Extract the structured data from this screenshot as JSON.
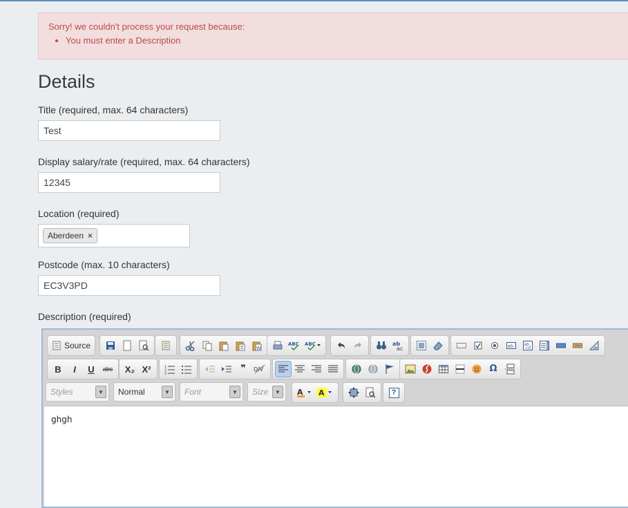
{
  "alert": {
    "intro": "Sorry! we couldn't process your request because:",
    "errors": [
      "You must enter a Description"
    ]
  },
  "section_title": "Details",
  "fields": {
    "title": {
      "label": "Title (required, max. 64 characters)",
      "value": "Test"
    },
    "salary": {
      "label": "Display salary/rate (required, max. 64 characters)",
      "value": "12345"
    },
    "location": {
      "label": "Location (required)",
      "tag": "Aberdeen",
      "remove_glyph": "×"
    },
    "postcode": {
      "label": "Postcode (max. 10 characters)",
      "value": "EC3V3PD"
    },
    "description": {
      "label": "Description (required)",
      "value": "ghgh"
    }
  },
  "editor": {
    "source_label": "Source",
    "combos": {
      "styles": "Styles",
      "format": "Normal",
      "font": "Font",
      "size": "Size"
    },
    "text_buttons": {
      "bold": "B",
      "italic": "I",
      "underline": "U",
      "strike": "abc",
      "subscript": "X₂",
      "superscript": "X²",
      "help": "?"
    }
  }
}
